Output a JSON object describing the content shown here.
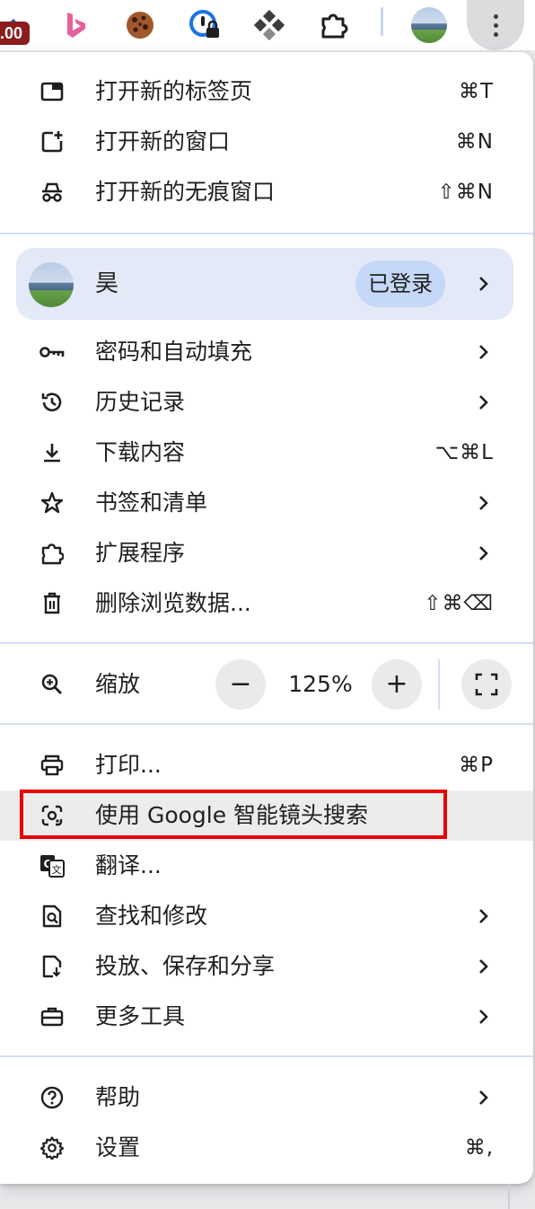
{
  "toolbar": {
    "badge_text": ".00",
    "icons": [
      "extension-partial-icon",
      "bing-icon",
      "cookie-icon",
      "password-lock-icon",
      "diamond-tiles-icon",
      "puzzle-extension-icon",
      "profile-avatar",
      "more-menu-icon"
    ]
  },
  "menu": {
    "new_tab": {
      "label": "打开新的标签页",
      "shortcut": "⌘T"
    },
    "new_window": {
      "label": "打开新的窗口",
      "shortcut": "⌘N"
    },
    "incognito": {
      "label": "打开新的无痕窗口",
      "shortcut": "⇧⌘N"
    },
    "profile": {
      "name": "昊",
      "status": "已登录"
    },
    "passwords": {
      "label": "密码和自动填充"
    },
    "history": {
      "label": "历史记录"
    },
    "downloads": {
      "label": "下载内容",
      "shortcut": "⌥⌘L"
    },
    "bookmarks": {
      "label": "书签和清单"
    },
    "extensions": {
      "label": "扩展程序"
    },
    "clear_data": {
      "label": "删除浏览数据...",
      "shortcut": "⇧⌘⌫"
    },
    "zoom": {
      "label": "缩放",
      "value": "125%",
      "minus": "−",
      "plus": "+"
    },
    "print": {
      "label": "打印...",
      "shortcut": "⌘P"
    },
    "lens": {
      "label": "使用 Google 智能镜头搜索"
    },
    "translate": {
      "label": "翻译..."
    },
    "find_edit": {
      "label": "查找和修改"
    },
    "cast_save": {
      "label": "投放、保存和分享"
    },
    "more_tools": {
      "label": "更多工具"
    },
    "help": {
      "label": "帮助"
    },
    "settings": {
      "label": "设置",
      "shortcut": "⌘,"
    }
  },
  "colors": {
    "highlight_border": "#e60000",
    "profile_bg": "#e3e9f6",
    "signed_chip": "#c5d8f7",
    "divider": "#d3def5"
  }
}
